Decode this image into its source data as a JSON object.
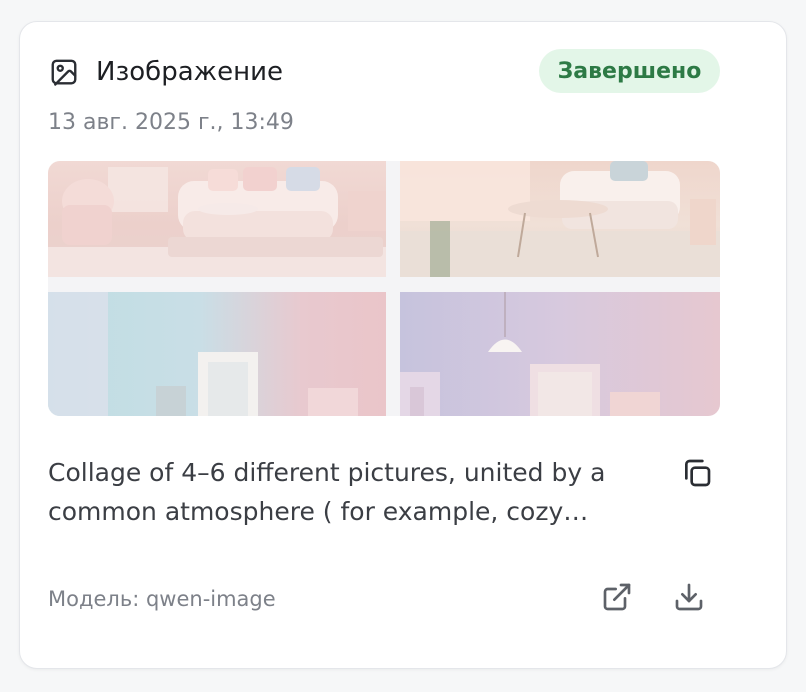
{
  "card": {
    "type_label": "Изображение",
    "type_icon": "image-icon",
    "status": "Завершено",
    "status_color": "#2d7a45",
    "status_background": "#e3f6e8",
    "timestamp": "13 авг. 2025 г., 13:49",
    "prompt": "Collage of 4–6 different pictures, united by a common atmosphere ( for example, cozy…",
    "model_label": "Модель: qwen-image",
    "actions": {
      "copy_icon": "copy-icon",
      "open_icon": "external-link-icon",
      "download_icon": "download-icon"
    }
  }
}
